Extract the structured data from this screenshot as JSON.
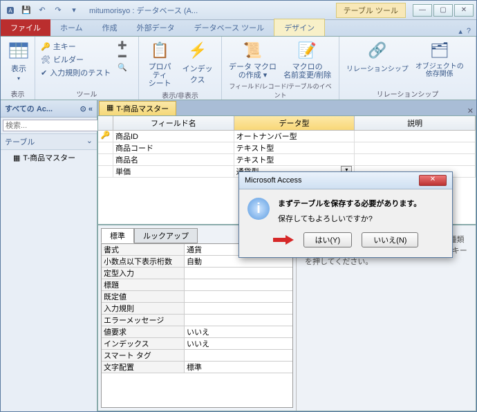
{
  "title": "mitumorisyo : データベース (A...",
  "ctx_tab": "テーブル ツール",
  "file_tab": "ファイル",
  "tabs": [
    "ホーム",
    "作成",
    "外部データ",
    "データベース ツール"
  ],
  "ctx_subtab": "デザイン",
  "ribbon": {
    "view": {
      "label": "表示",
      "group": "表示"
    },
    "tools": {
      "pk": "主キー",
      "builder": "ビルダー",
      "rules": "入力規則のテスト",
      "group": "ツール"
    },
    "showhide": {
      "prop": "プロパティ\nシート",
      "index": "インデックス",
      "group": "表示/非表示"
    },
    "events": {
      "macro": "データ マクロ\nの作成 ▾",
      "rename": "マクロの\n名前変更/削除",
      "group": "フィールド/レコード/テーブルのイベント"
    },
    "rel": {
      "rel": "リレーションシップ",
      "dep": "オブジェクトの\n依存関係",
      "group": "リレーションシップ"
    }
  },
  "nav": {
    "title": "すべての Ac...",
    "search_placeholder": "検索...",
    "group": "テーブル",
    "item": "T-商品マスター"
  },
  "doc_tab": "T-商品マスター",
  "grid": {
    "headers": [
      "フィールド名",
      "データ型",
      "説明"
    ],
    "rows": [
      {
        "pk": true,
        "name": "商品ID",
        "type": "オートナンバー型"
      },
      {
        "pk": false,
        "name": "商品コード",
        "type": "テキスト型"
      },
      {
        "pk": false,
        "name": "商品名",
        "type": "テキスト型"
      },
      {
        "pk": false,
        "name": "単価",
        "type": "通貨型",
        "dd": true
      }
    ]
  },
  "props": {
    "tabs": [
      "標準",
      "ルックアップ"
    ],
    "rows": [
      [
        "書式",
        "通貨"
      ],
      [
        "小数点以下表示桁数",
        "自動"
      ],
      [
        "定型入力",
        ""
      ],
      [
        "標題",
        ""
      ],
      [
        "既定値",
        ""
      ],
      [
        "入力規則",
        ""
      ],
      [
        "エラーメッセージ",
        ""
      ],
      [
        "値要求",
        "いいえ"
      ],
      [
        "インデックス",
        "いいえ"
      ],
      [
        "スマート タグ",
        ""
      ],
      [
        "文字配置",
        "標準"
      ]
    ],
    "help": "データ型にはフィールドに保存できる値の種類を設定します。ヘルプを表示するには、F1 キーを押してください。"
  },
  "dialog": {
    "title": "Microsoft Access",
    "msg1": "まずテーブルを保存する必要があります。",
    "msg2": "保存してもよろしいですか?",
    "yes": "はい(Y)",
    "no": "いいえ(N)"
  }
}
